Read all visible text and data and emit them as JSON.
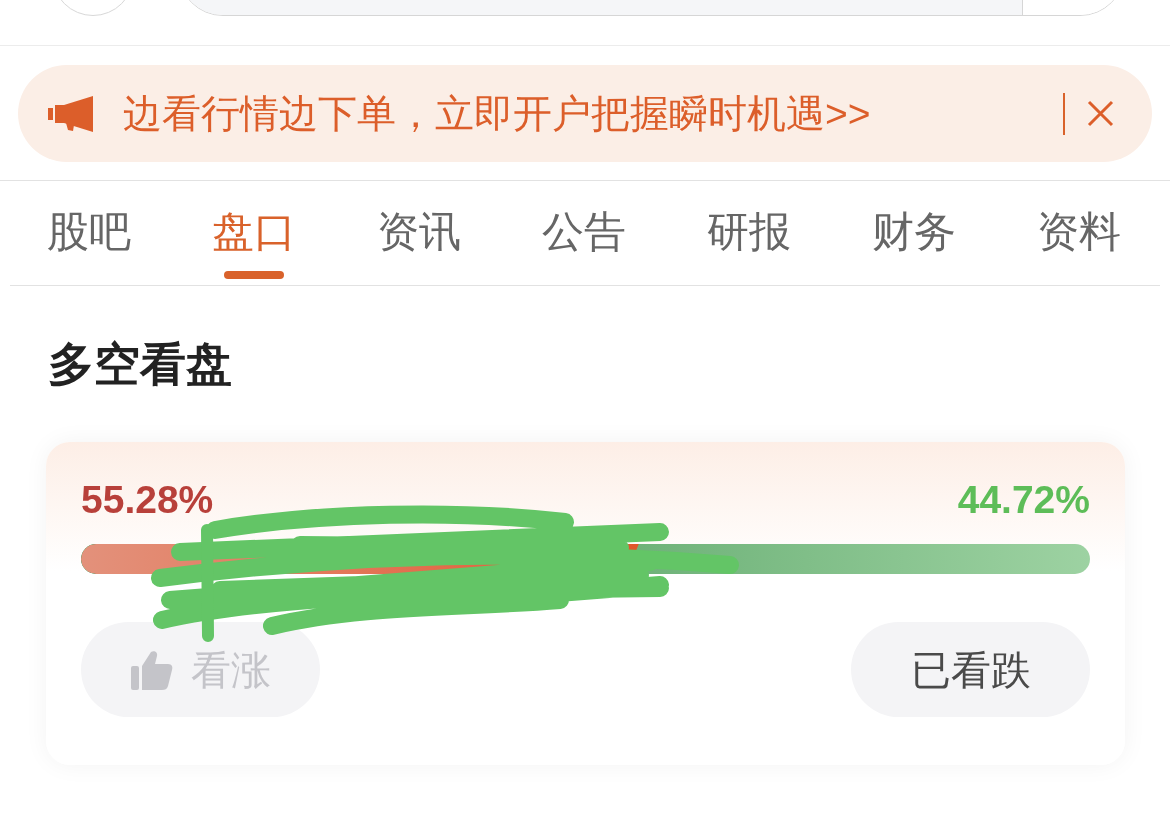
{
  "banner": {
    "text": "边看行情边下单，立即开户把握瞬时机遇>>"
  },
  "tabs": [
    {
      "label": "股吧",
      "selected": false
    },
    {
      "label": "盘口",
      "selected": true
    },
    {
      "label": "资讯",
      "selected": false
    },
    {
      "label": "公告",
      "selected": false
    },
    {
      "label": "研报",
      "selected": false
    },
    {
      "label": "财务",
      "selected": false
    },
    {
      "label": "资料",
      "selected": false
    }
  ],
  "section": {
    "title": "多空看盘"
  },
  "sentiment": {
    "bull_percent": "55.28%",
    "bear_percent": "44.72%",
    "level": 0.5528
  },
  "vote_buttons": [
    {
      "kind": "bull",
      "label": "看涨",
      "disabled": true
    },
    {
      "kind": "bear",
      "label": "已看跌",
      "disabled": false
    }
  ]
}
